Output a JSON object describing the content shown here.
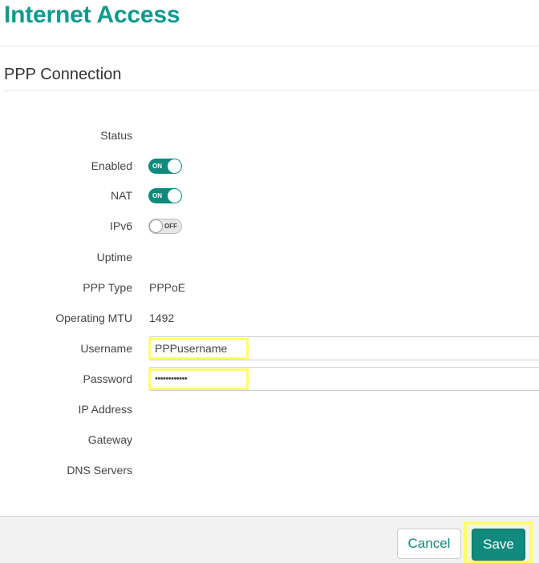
{
  "page": {
    "title": "Internet Access"
  },
  "section": {
    "title": "PPP Connection"
  },
  "fields": {
    "status": {
      "label": "Status",
      "value": ""
    },
    "enabled": {
      "label": "Enabled",
      "toggle_text": "ON",
      "state": "on"
    },
    "nat": {
      "label": "NAT",
      "toggle_text": "ON",
      "state": "on"
    },
    "ipv6": {
      "label": "IPv6",
      "toggle_text": "OFF",
      "state": "off"
    },
    "uptime": {
      "label": "Uptime",
      "value": ""
    },
    "ppp_type": {
      "label": "PPP Type",
      "value": "PPPoE"
    },
    "operating_mtu": {
      "label": "Operating MTU",
      "value": "1492"
    },
    "username": {
      "label": "Username",
      "value": "PPPusername"
    },
    "password": {
      "label": "Password",
      "value": "••••••••••••"
    },
    "ip_address": {
      "label": "IP Address",
      "value": ""
    },
    "gateway": {
      "label": "Gateway",
      "value": ""
    },
    "dns_servers": {
      "label": "DNS Servers",
      "value": ""
    }
  },
  "footer": {
    "cancel_label": "Cancel",
    "save_label": "Save"
  },
  "colors": {
    "accent": "#0f9a8c",
    "button_primary": "#0f8a7c",
    "highlight": "#ffff66"
  }
}
